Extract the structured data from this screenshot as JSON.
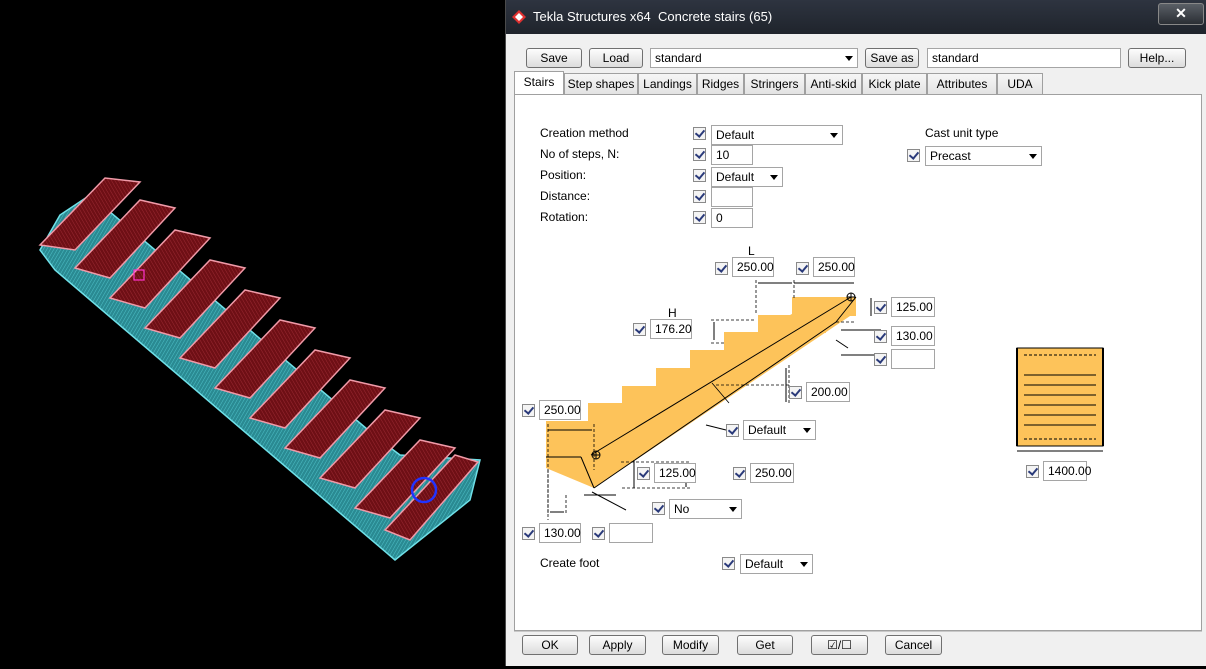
{
  "dialog": {
    "title": "Tekla Structures x64  Concrete stairs (65)",
    "close_label": "✕",
    "toolbar": {
      "save_label": "Save",
      "load_label": "Load",
      "preset_value": "standard",
      "save_as_label": "Save as",
      "save_as_value": "standard",
      "help_label": "Help..."
    },
    "tabs": [
      {
        "label": "Stairs"
      },
      {
        "label": "Step shapes"
      },
      {
        "label": "Landings"
      },
      {
        "label": "Ridges"
      },
      {
        "label": "Stringers"
      },
      {
        "label": "Anti-skid"
      },
      {
        "label": "Kick plate"
      },
      {
        "label": "Attributes"
      },
      {
        "label": "UDA"
      }
    ],
    "stairs": {
      "creation_method_label": "Creation method",
      "creation_method_value": "Default",
      "steps_label": "No of steps, N:",
      "steps_value": "10",
      "position_label": "Position:",
      "position_value": "Default",
      "distance_label": "Distance:",
      "distance_value": "",
      "rotation_label": "Rotation:",
      "rotation_value": "0",
      "cast_unit_label": "Cast unit type",
      "cast_unit_value": "Precast",
      "L_label": "L",
      "L_value1": "250.00",
      "L_value2": "250.00",
      "H_label": "H",
      "H_value": "176.20",
      "top_offset1": "125.00",
      "top_offset2": "130.00",
      "top_offset3": "",
      "thickness": "200.00",
      "slab_type": "Default",
      "left_length": "250.00",
      "bottom_step": "125.00",
      "bottom_height": "250.00",
      "bottom_option": "No",
      "bottom_offset1": "130.00",
      "bottom_offset2": "",
      "width_value": "1400.00",
      "create_foot_label": "Create foot",
      "create_foot_value": "Default"
    },
    "footer": {
      "ok": "OK",
      "apply": "Apply",
      "modify": "Modify",
      "get": "Get",
      "toggle": "☑/☐",
      "cancel": "Cancel"
    }
  },
  "colors": {
    "stair_fill": "#fdc35a",
    "step_red": "#7a1218",
    "step_edge": "#e48a9a",
    "stringer_cyan": "#3aa8b0"
  }
}
